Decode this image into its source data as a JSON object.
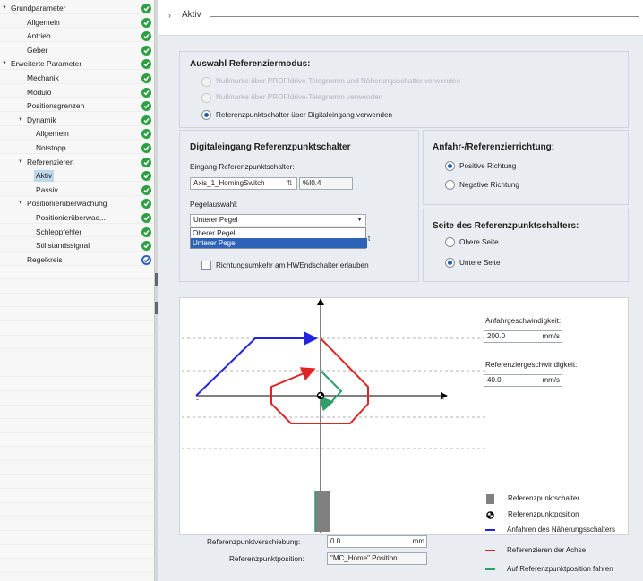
{
  "tree": {
    "items": [
      {
        "label": "Grundparameter",
        "arrow": "▼",
        "status": "ok"
      },
      {
        "label": "Allgemein",
        "arrow": "",
        "status": "ok"
      },
      {
        "label": "Antrieb",
        "arrow": "",
        "status": "ok"
      },
      {
        "label": "Geber",
        "arrow": "",
        "status": "ok"
      },
      {
        "label": "Erweiterte Parameter",
        "arrow": "▼",
        "status": "ok"
      },
      {
        "label": "Mechanik",
        "arrow": "",
        "status": "ok"
      },
      {
        "label": "Modulo",
        "arrow": "",
        "status": "ok"
      },
      {
        "label": "Positionsgrenzen",
        "arrow": "",
        "status": "ok"
      },
      {
        "label": "Dynamik",
        "arrow": "▼",
        "status": "ok"
      },
      {
        "label": "Allgemein",
        "arrow": "",
        "status": "ok"
      },
      {
        "label": "Notstopp",
        "arrow": "",
        "status": "ok"
      },
      {
        "label": "Referenzieren",
        "arrow": "▼",
        "status": "ok"
      },
      {
        "label": "Aktiv",
        "arrow": "",
        "status": "ok",
        "selected": true
      },
      {
        "label": "Passiv",
        "arrow": "",
        "status": "ok"
      },
      {
        "label": "Positionierüberwachung",
        "arrow": "▼",
        "status": "ok"
      },
      {
        "label": "Positionierüberwac...",
        "arrow": "",
        "status": "ok"
      },
      {
        "label": "Schleppfehler",
        "arrow": "",
        "status": "ok"
      },
      {
        "label": "Stillstandssignal",
        "arrow": "",
        "status": "ok"
      },
      {
        "label": "Regelkreis",
        "arrow": "",
        "status": "blue"
      }
    ]
  },
  "header": {
    "chevron": "›",
    "title": "Aktiv"
  },
  "modus": {
    "title": "Auswahl Referenziermodus:",
    "options": [
      "Nullmarke über PROFIdrive-Telegramm und Näherungsschalter verwenden",
      "Nullmarke über PROFIdrive-Telegramm verwenden",
      "Referenzpunktschalter über Digitaleingang verwenden"
    ],
    "selected": 2
  },
  "digital": {
    "title": "Digitaleingang Referenzpunktschalter",
    "input_label": "Eingang Referenzpunktschalter:",
    "input_value": "Axis_1_HomingSwitch",
    "input_addr": "%I0.4",
    "pegel_label": "Pegelauswahl:",
    "pegel_value": "Unterer Pegel",
    "dropdown_options": [
      "Oberer Pegel",
      "Unterer Pegel"
    ],
    "dropdown_highlight": 1,
    "checkbox_label": "Richtungsumkehr am HWEndschalter erlauben"
  },
  "richtung": {
    "title": "Anfahr-/Referenzierrichtung:",
    "options": [
      "Positive Richtung",
      "Negative Richtung"
    ],
    "selected": 0
  },
  "seite": {
    "title": "Seite des Referenzpunktschalters:",
    "options": [
      "Obere Seite",
      "Untere Seite"
    ],
    "selected": 1
  },
  "speeds": {
    "anfahr_label": "Anfahrgeschwindigkeit:",
    "anfahr_value": "200.0",
    "anfahr_unit": "mm/s",
    "ref_label": "Referenziergeschwindigkeit:",
    "ref_value": "40.0",
    "ref_unit": "mm/s"
  },
  "axis_signs": {
    "minus": "-",
    "plus": "+"
  },
  "offset": {
    "verschiebung_label": "Referenzpunktverschiebung:",
    "verschiebung_value": "0.0",
    "verschiebung_unit": "mm",
    "position_label": "Referenzpunktposition:",
    "position_value": "\"MC_Home\".Position"
  },
  "legend": [
    {
      "label": "Referenzpunktschalter",
      "symbol": "gray-square",
      "color": "#808080"
    },
    {
      "label": "Referenzpunktposition",
      "symbol": "target-icon",
      "color": "#000000"
    },
    {
      "label": "Anfahren des Näherungsschalters",
      "symbol": "line",
      "color": "#2424e0"
    },
    {
      "label": "Referenzieren der Achse",
      "symbol": "line",
      "color": "#e02424"
    },
    {
      "label": "Auf Referenzpunktposition fahren",
      "symbol": "line",
      "color": "#2e9e6a"
    }
  ],
  "colors": {
    "ok": "#2ea043",
    "accent": "#2c62b8",
    "panel": "#e9edf2"
  }
}
